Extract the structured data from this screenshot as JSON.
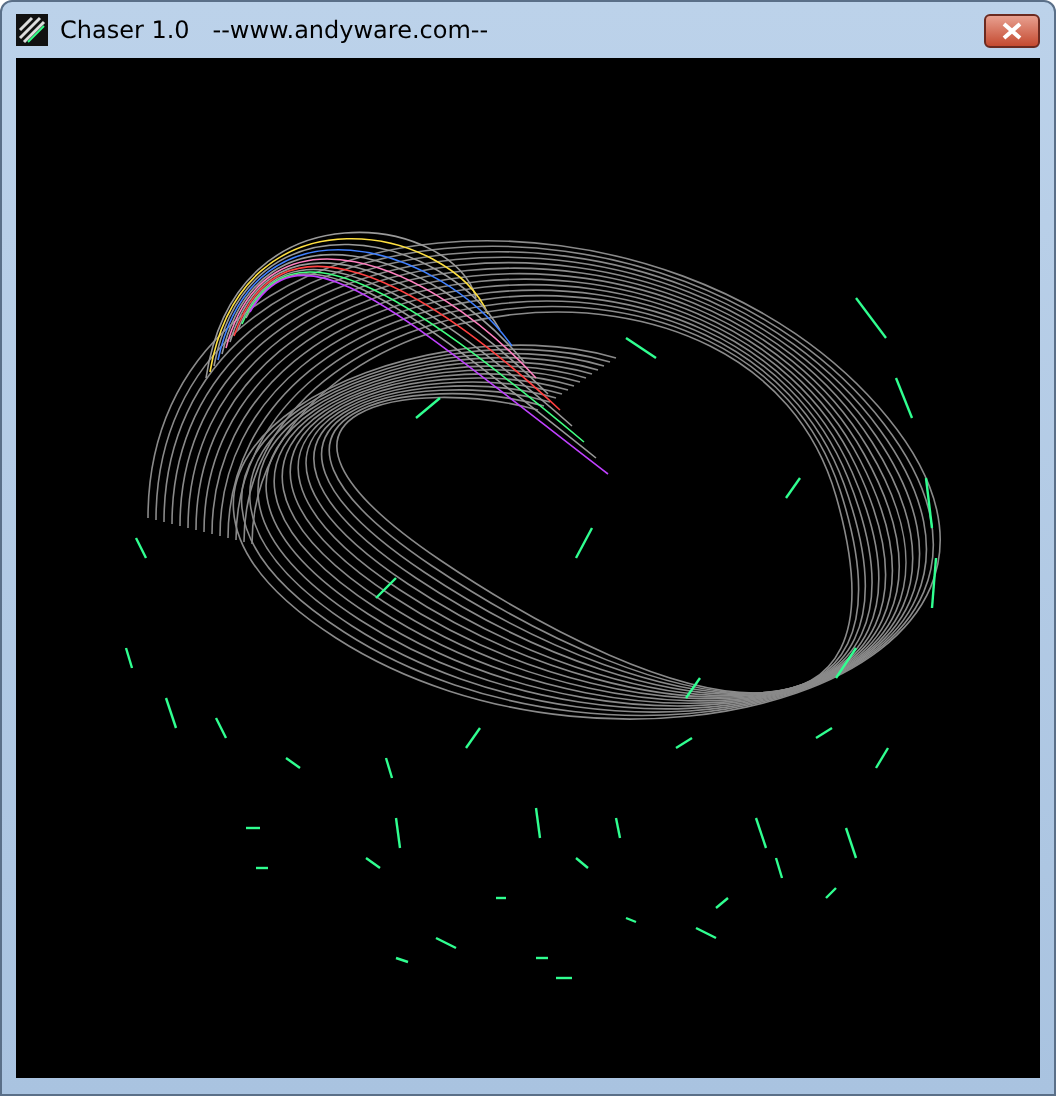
{
  "window": {
    "title": "Chaser 1.0   --www.andyware.com--"
  }
}
